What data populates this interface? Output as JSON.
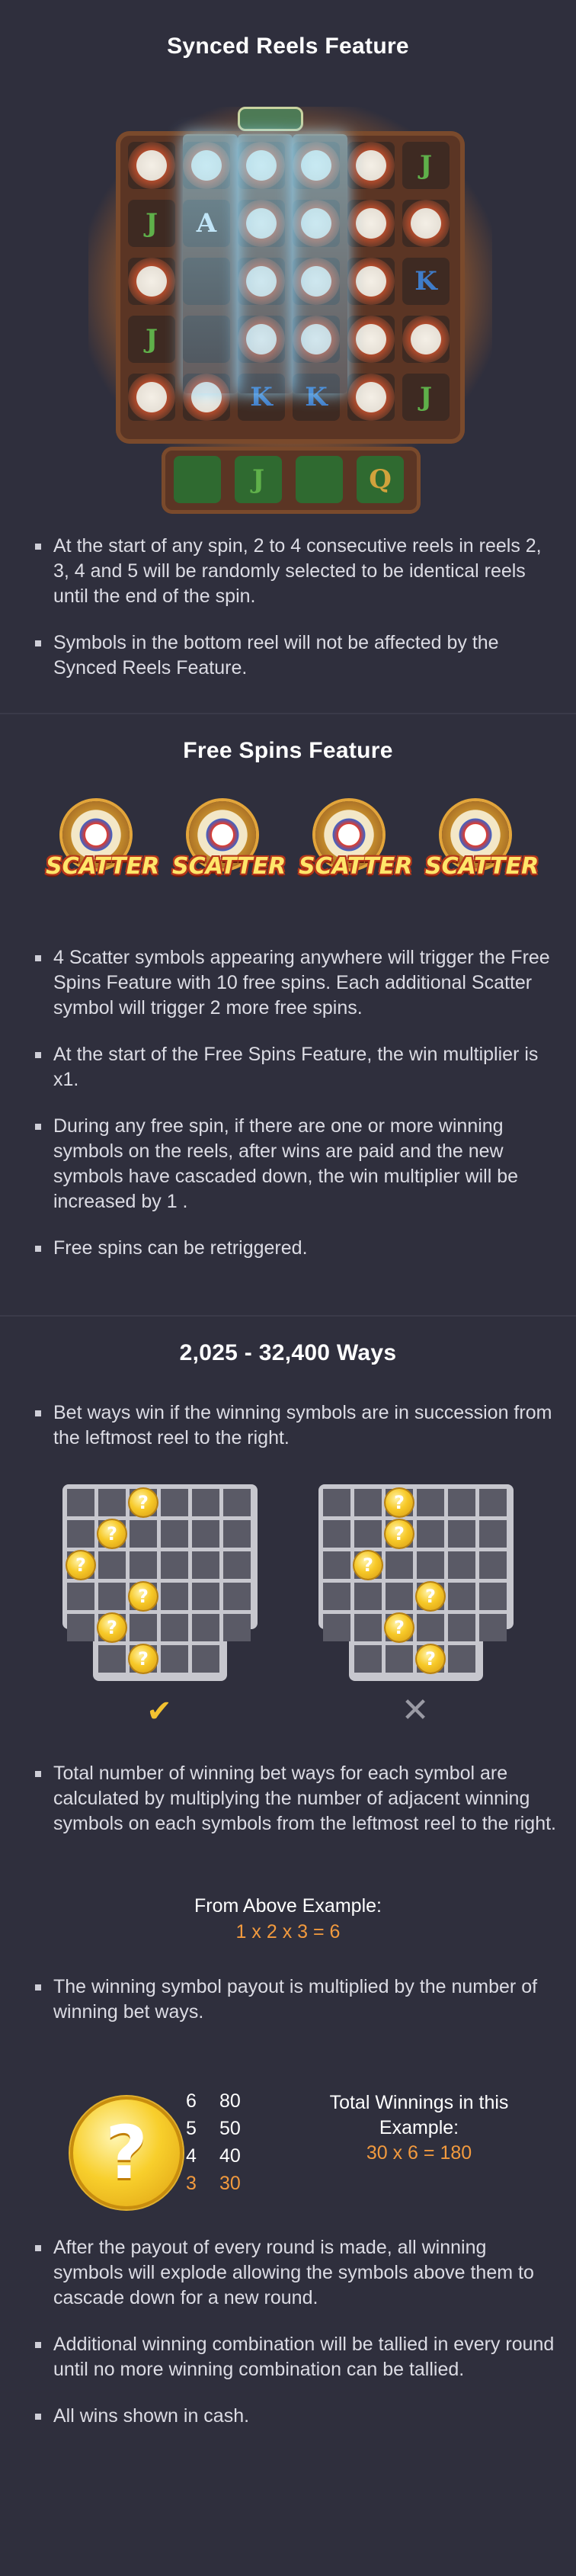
{
  "synced": {
    "title": "Synced Reels Feature",
    "bullets": [
      "At the start of any spin, 2 to 4 consecutive reels in reels 2, 3, 4 and 5 will be randomly selected to be identical reels until the end of the spin.",
      "Symbols in the bottom reel will not be affected by the Synced Reels Feature."
    ]
  },
  "free_spins": {
    "title": "Free Spins Feature",
    "scatter_label": "SCATTER",
    "bullets": [
      "4 Scatter symbols appearing anywhere will trigger the Free Spins Feature with 10 free spins. Each additional Scatter symbol will trigger 2 more free spins.",
      "At the start of the Free Spins Feature, the win multiplier is x1.",
      "During any free spin, if there are one or more winning symbols on the reels, after wins are paid and the new symbols have cascaded down, the win multiplier will be increased by 1 .",
      "Free spins can be retriggered."
    ]
  },
  "ways": {
    "title": "2,025 - 32,400 Ways",
    "bullet1": "Bet ways win if the winning symbols are in succession from the leftmost reel to the right.",
    "valid_mark": "✔",
    "invalid_mark": "✕",
    "bullet2": "Total number of winning bet ways for each symbol are calculated by multiplying the number of adjacent winning symbols on each symbols from the leftmost reel to the right.",
    "example_label": "From Above Example:",
    "example_calc": "1 x 2 x 3 = 6",
    "bullet3": "The winning symbol payout is multiplied by the number of winning bet ways.",
    "coin_symbol": "?",
    "paytable": [
      {
        "count": "6",
        "pay": "80",
        "highlight": false
      },
      {
        "count": "5",
        "pay": "50",
        "highlight": false
      },
      {
        "count": "4",
        "pay": "40",
        "highlight": false
      },
      {
        "count": "3",
        "pay": "30",
        "highlight": true
      }
    ],
    "total_label": "Total Winnings in this Example:",
    "total_calc": "30 x 6 = 180",
    "bullets_end": [
      "After the payout of every round is made, all winning symbols will explode allowing the symbols above them to cascade down for a new round.",
      "Additional winning combination will be tallied in every round until no more winning combination can be tallied.",
      "All wins shown in cash."
    ]
  },
  "colors": {
    "background": "#2f2f3d",
    "accent_orange": "#f29a3e",
    "check_yellow": "#f2c230",
    "cross_gray": "#9a9aa4"
  }
}
